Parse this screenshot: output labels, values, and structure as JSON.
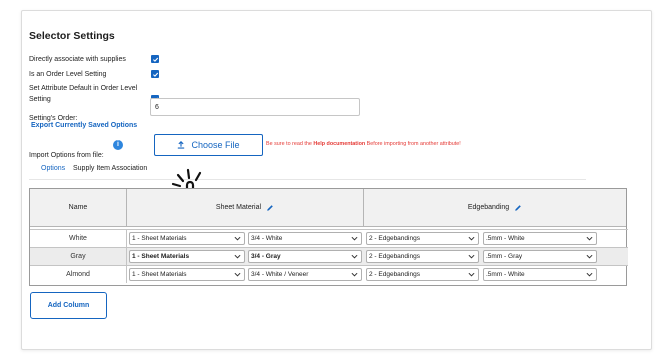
{
  "section": {
    "title": "Selector Settings"
  },
  "settings": {
    "direct_associate_label": "Directly associate with supplies",
    "order_level_label": "Is an Order Level Setting",
    "attr_default_line1": "Set Attribute Default in Order Level",
    "attr_default_line2": "Setting",
    "order_label": "Setting's Order:",
    "order_value": "6"
  },
  "export": {
    "label": "Export Currently Saved Options"
  },
  "import": {
    "label": "Import Options from file:",
    "choose_file_label": "Choose File",
    "warning_prefix": "Be sure to read the ",
    "warning_link": "Help documentation",
    "warning_suffix": " Before importing from another attribute!"
  },
  "tabs": [
    {
      "label": "Options"
    },
    {
      "label": "Supply Item Association"
    }
  ],
  "table": {
    "headers": {
      "name": "Name",
      "sheet": "Sheet Material",
      "edge": "Edgebanding"
    },
    "rows": [
      {
        "name": "White",
        "sheet_cat": "1 - Sheet Materials",
        "sheet_item": "3/4 - White",
        "edge_cat": "2 - Edgebandings",
        "edge_item": ".5mm - White"
      },
      {
        "name": "Gray",
        "sheet_cat": "1 - Sheet Materials",
        "sheet_item": "3/4 - Gray",
        "edge_cat": "2 - Edgebandings",
        "edge_item": ".5mm - Gray"
      },
      {
        "name": "Almond",
        "sheet_cat": "1 - Sheet Materials",
        "sheet_item": "3/4 - White / Veneer",
        "edge_cat": "2 - Edgebandings",
        "edge_item": ".5mm - White"
      }
    ]
  },
  "add_column": {
    "label": "Add Column"
  },
  "colors": {
    "accent": "#1565c0",
    "warning": "#e53935"
  }
}
